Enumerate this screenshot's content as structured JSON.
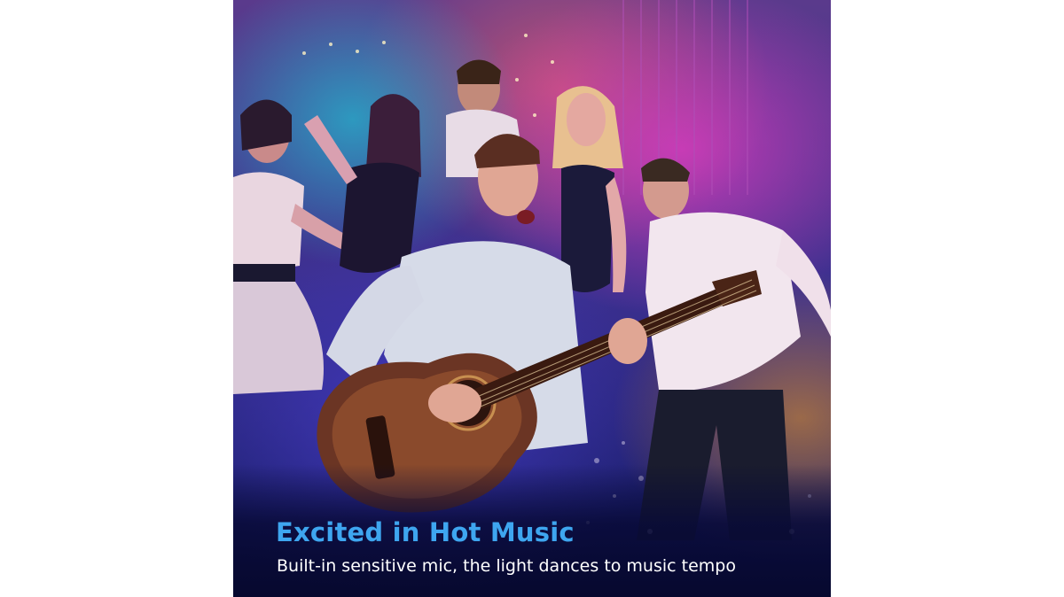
{
  "image": {
    "subject": "party-scene-guitarist-with-dancing-friends",
    "colors": {
      "headline": "#3ea6f0",
      "subline": "#ffffff",
      "background": "#ffffff"
    }
  },
  "caption": {
    "headline": "Excited in Hot Music",
    "subline": "Built-in sensitive mic, the light dances to music tempo"
  }
}
